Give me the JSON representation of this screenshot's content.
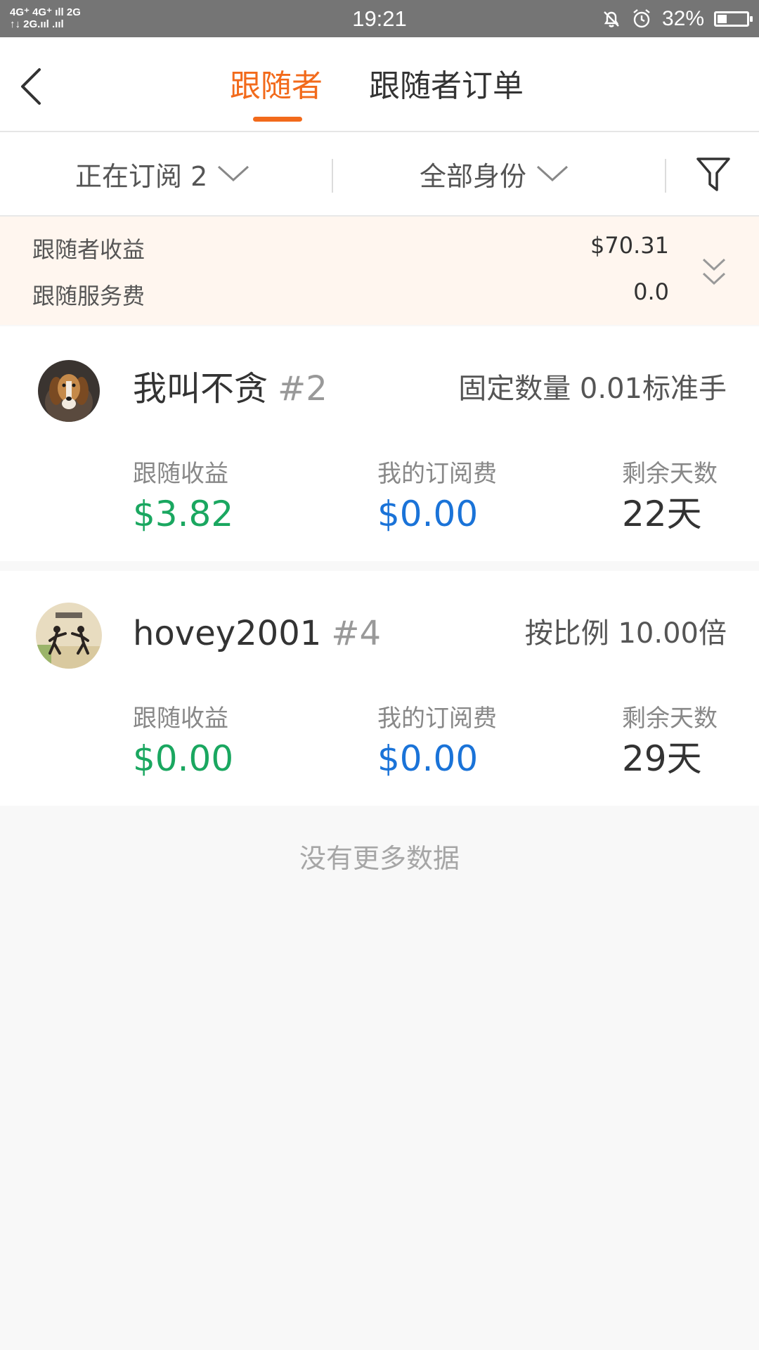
{
  "status_bar": {
    "signal_line1": "4G⁺ 4G⁺ ıll  2G",
    "signal_line2": "↑↓ 2G.ııl  .ııl",
    "time": "19:21",
    "battery_percent": "32%",
    "battery_level": 0.32
  },
  "header": {
    "tabs": [
      {
        "label": "跟随者",
        "active": true
      },
      {
        "label": "跟随者订单",
        "active": false
      }
    ]
  },
  "filters": {
    "subscription": "正在订阅 2",
    "identity": "全部身份"
  },
  "summary": {
    "earnings_label": "跟随者收益",
    "earnings_value": "$70.31",
    "fee_label": "跟随服务费",
    "fee_value": "0.0"
  },
  "followers": [
    {
      "name": "我叫不贪",
      "rank": "#2",
      "mode": "固定数量 0.01标准手",
      "stats": [
        {
          "label": "跟随收益",
          "value": "$3.82"
        },
        {
          "label": "我的订阅费",
          "value": "$0.00"
        },
        {
          "label": "剩余天数",
          "value": "22天"
        }
      ]
    },
    {
      "name": "hovey2001",
      "rank": "#4",
      "mode": "按比例 10.00倍",
      "stats": [
        {
          "label": "跟随收益",
          "value": "$0.00"
        },
        {
          "label": "我的订阅费",
          "value": "$0.00"
        },
        {
          "label": "剩余天数",
          "value": "29天"
        }
      ]
    }
  ],
  "footer": {
    "no_more": "没有更多数据"
  },
  "colors": {
    "accent": "#f26a1b",
    "earnings_green": "#1aa760",
    "fee_blue": "#1a73d8",
    "summary_bg": "#fff6ef"
  }
}
